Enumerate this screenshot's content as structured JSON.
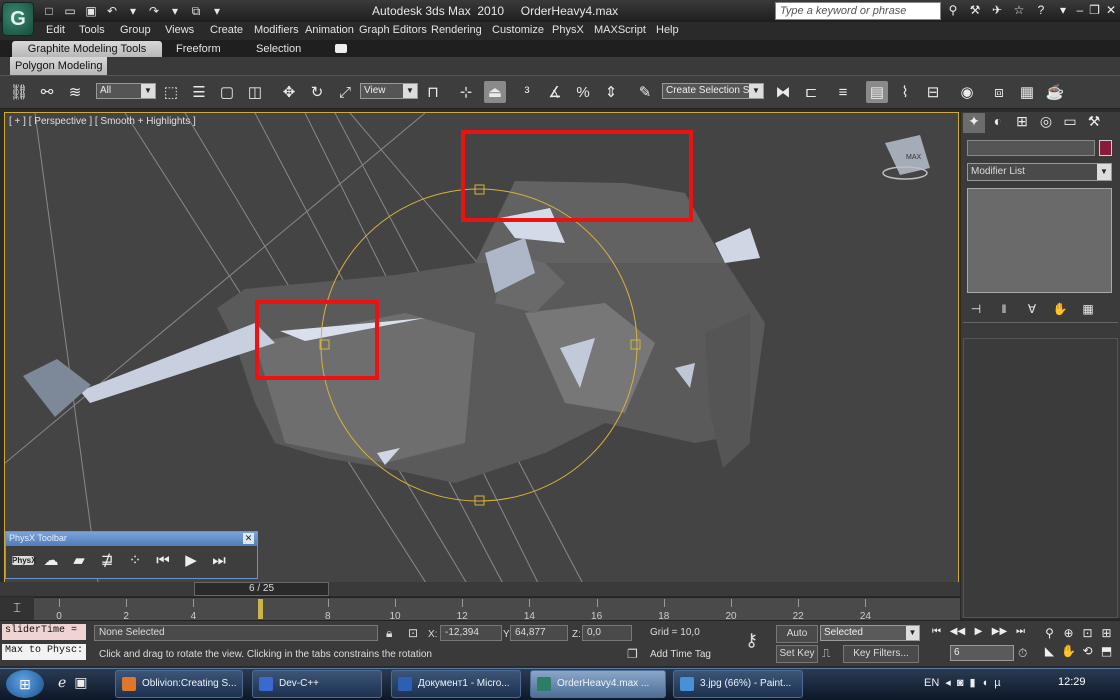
{
  "app": {
    "logo_text": "G",
    "window_title": "Autodesk 3ds Max  2010     OrderHeavy4.max",
    "search_placeholder": "Type a keyword or phrase"
  },
  "quick_access": [
    {
      "name": "new-file-icon",
      "glyph": "□"
    },
    {
      "name": "open-file-icon",
      "glyph": "▭"
    },
    {
      "name": "save-icon",
      "glyph": "▣"
    },
    {
      "name": "undo-icon",
      "glyph": "↶"
    },
    {
      "name": "undo-dropdown-icon",
      "glyph": "▾"
    },
    {
      "name": "redo-icon",
      "glyph": "↷"
    },
    {
      "name": "redo-dropdown-icon",
      "glyph": "▾"
    },
    {
      "name": "project-folder-icon",
      "glyph": "⧉"
    },
    {
      "name": "quick-access-dropdown-icon",
      "glyph": "▾"
    }
  ],
  "title_icons": [
    {
      "name": "binoculars-icon",
      "glyph": "⚲"
    },
    {
      "name": "tools-icon",
      "glyph": "⚒"
    },
    {
      "name": "communication-center-icon",
      "glyph": "✈"
    },
    {
      "name": "favorites-star-icon",
      "glyph": "☆"
    },
    {
      "name": "help-icon",
      "glyph": "?"
    },
    {
      "name": "help-dropdown-icon",
      "glyph": "▾"
    }
  ],
  "window_controls": [
    {
      "name": "minimize-icon",
      "glyph": "–"
    },
    {
      "name": "restore-icon",
      "glyph": "❐"
    },
    {
      "name": "close-icon",
      "glyph": "✕"
    }
  ],
  "menu": [
    "Edit",
    "Tools",
    "Group",
    "Views",
    "Create",
    "Modifiers",
    "Animation",
    "Graph Editors",
    "Rendering",
    "Customize",
    "PhysX",
    "MAXScript",
    "Help"
  ],
  "ribbon": {
    "tabs": [
      "Graphite Modeling Tools",
      "Freeform",
      "Selection"
    ],
    "panel": "Polygon Modeling"
  },
  "toolbar": {
    "selection_filter": "All",
    "reference_coord": "View",
    "named_selection": "Create Selection Se"
  },
  "viewport": {
    "label": "[ + ] [ Perspective ] [ Smooth + Highlights ]",
    "cube_text": "MAX"
  },
  "physx_toolbar": {
    "title": "PhysX Toolbar",
    "logo_text": "PhysX"
  },
  "command_panel": {
    "modifier_list": "Modifier List"
  },
  "timeline": {
    "slider_label": "6 / 25",
    "ticks": [
      "0",
      "2",
      "4",
      "6",
      "8",
      "10",
      "12",
      "14",
      "16",
      "18",
      "20",
      "22",
      "24"
    ]
  },
  "status": {
    "script_line_1": "sliderTime =",
    "script_line_2": "Max to Physc:",
    "selection_status": "None Selected",
    "prompt": "Click and drag to rotate the view.  Clicking in the tabs constrains the rotation",
    "x_label": "X:",
    "x_value": "-12,394",
    "y_label": "Y:",
    "y_value": "64,877",
    "z_label": "Z:",
    "z_value": "0,0",
    "grid": "Grid = 10,0",
    "add_time_tag": "Add Time Tag",
    "auto_key": "Auto Key",
    "set_key": "Set Key",
    "key_mode": "Selected",
    "key_filters": "Key Filters...",
    "current_frame": "6"
  },
  "taskbar": {
    "tasks": [
      {
        "label": "Oblivion:Creating S...",
        "color": "#e0762a"
      },
      {
        "label": "Dev-C++",
        "color": "#3a6ad0"
      },
      {
        "label": "Документ1 - Micro...",
        "color": "#2d5fb3"
      },
      {
        "label": "OrderHeavy4.max ...",
        "color": "#2e7d67"
      },
      {
        "label": "3.jpg (66%) - Paint...",
        "color": "#4a90d9"
      }
    ],
    "language": "EN",
    "clock": "12:29"
  },
  "colors": {
    "selection_box": "#ee1111",
    "gizmo": "#d8b23c",
    "viewport_border": "#d4aa33"
  }
}
